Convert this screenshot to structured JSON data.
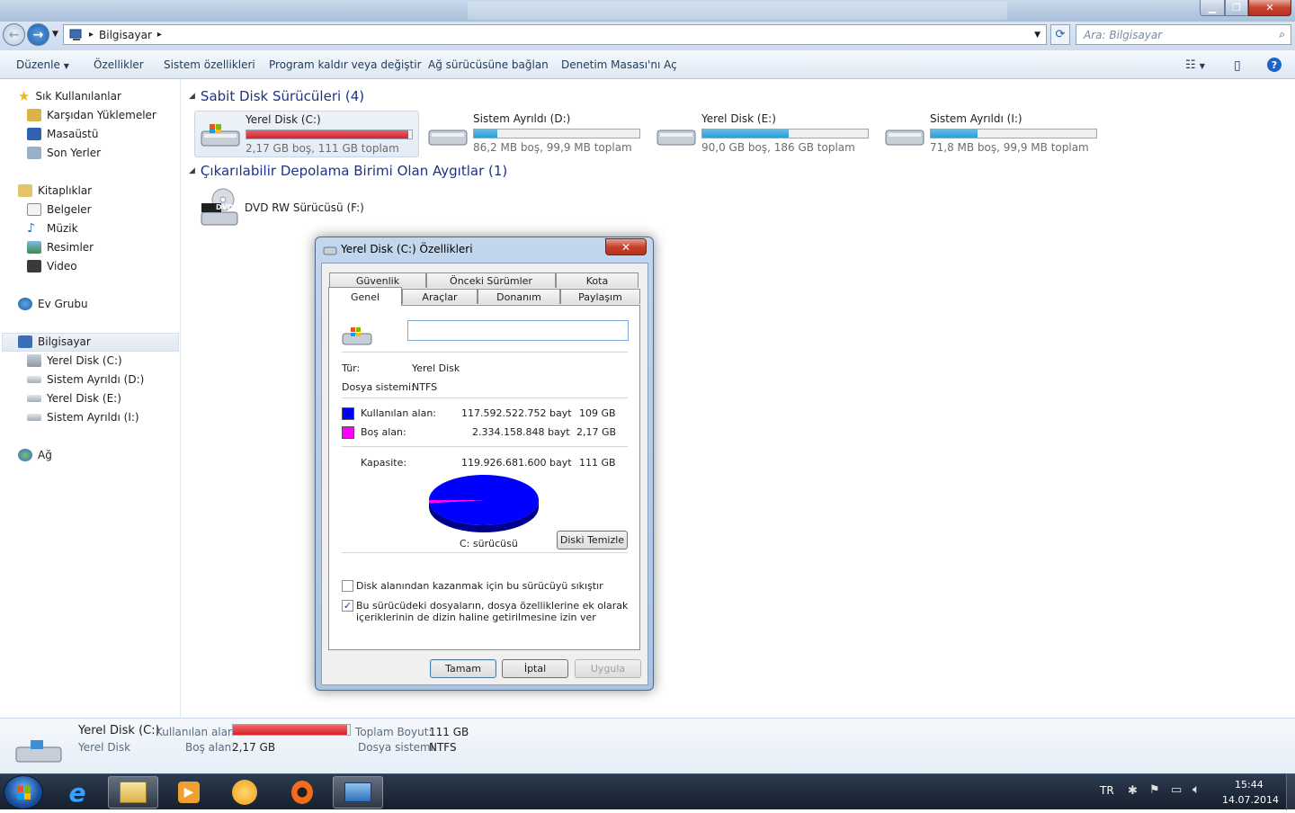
{
  "window": {
    "minimize_glyph": "▁",
    "maximize_glyph": "❐",
    "close_glyph": "✕"
  },
  "address": {
    "breadcrumb": "Bilgisayar",
    "search_placeholder": "Ara: Bilgisayar"
  },
  "toolbar": {
    "organize": "Düzenle",
    "properties": "Özellikler",
    "system_properties": "Sistem özellikleri",
    "uninstall": "Program kaldır veya değiştir",
    "map_drive": "Ağ sürücüsüne bağlan",
    "control_panel": "Denetim Masası'nı Aç"
  },
  "sidebar": {
    "favorites": {
      "label": "Sık Kullanılanlar",
      "items": [
        "Karşıdan Yüklemeler",
        "Masaüstü",
        "Son Yerler"
      ]
    },
    "libraries": {
      "label": "Kitaplıklar",
      "items": [
        "Belgeler",
        "Müzik",
        "Resimler",
        "Video"
      ]
    },
    "homegroup": "Ev Grubu",
    "computer": {
      "label": "Bilgisayar",
      "items": [
        "Yerel Disk (C:)",
        "Sistem Ayrıldı (D:)",
        "Yerel Disk (E:)",
        "Sistem Ayrıldı (I:)"
      ]
    },
    "network": "Ağ"
  },
  "groups": {
    "hdd_title": "Sabit Disk Sürücüleri (4)",
    "removable_title": "Çıkarılabilir Depolama Birimi Olan Aygıtlar (1)"
  },
  "drives": [
    {
      "name": "Yerel Disk (C:)",
      "free": "2,17 GB boş, 111 GB toplam",
      "used_fraction": 0.98,
      "color": "#d8202a"
    },
    {
      "name": "Sistem Ayrıldı (D:)",
      "free": "86,2 MB boş, 99,9 MB toplam",
      "used_fraction": 0.14,
      "color": "#26a0da"
    },
    {
      "name": "Yerel Disk (E:)",
      "free": "90,0 GB boş, 186 GB toplam",
      "used_fraction": 0.52,
      "color": "#26a0da"
    },
    {
      "name": "Sistem Ayrıldı (I:)",
      "free": "71,8 MB boş, 99,9 MB toplam",
      "used_fraction": 0.28,
      "color": "#26a0da"
    }
  ],
  "dvd": {
    "name": "DVD RW Sürücüsü (F:)",
    "badge": "DVD"
  },
  "dialog": {
    "title": "Yerel Disk (C:) Özellikleri",
    "close_glyph": "✕",
    "tabs_back": [
      "Güvenlik",
      "Önceki Sürümler",
      "Kota"
    ],
    "tabs_front": [
      "Genel",
      "Araçlar",
      "Donanım",
      "Paylaşım"
    ],
    "volume_label_value": "",
    "type_label": "Tür:",
    "type_value": "Yerel Disk",
    "fs_label": "Dosya sistemi:",
    "fs_value": "NTFS",
    "used_label": "Kullanılan alan:",
    "used_bytes": "117.592.522.752 bayt",
    "used_gb": "109 GB",
    "used_color": "#0000ff",
    "free_label": "Boş alan:",
    "free_bytes": "2.334.158.848 bayt",
    "free_gb": "2,17 GB",
    "free_color": "#ff00ff",
    "capacity_label": "Kapasite:",
    "capacity_bytes": "119.926.681.600 bayt",
    "capacity_gb": "111 GB",
    "pie_used_fraction": 0.9805,
    "drive_caption": "C: sürücüsü",
    "cleanup": "Diski Temizle",
    "compress": "Disk alanından kazanmak için bu sürücüyü sıkıştır",
    "compress_checked": false,
    "index_line1": "Bu sürücüdeki dosyaların, dosya özelliklerine ek olarak",
    "index_line2": "içeriklerinin de dizin haline getirilmesine izin ver",
    "index_checked": true,
    "check_glyph": "✓",
    "ok": "Tamam",
    "cancel": "İptal",
    "apply": "Uygula"
  },
  "details": {
    "name": "Yerel Disk (C:)",
    "type": "Yerel Disk",
    "used_label": "Kullanılan alan:",
    "free_label": "Boş alan:",
    "free_value": "2,17 GB",
    "total_label": "Toplam Boyut:",
    "total_value": "111 GB",
    "fs_label": "Dosya sistemi:",
    "fs_value": "NTFS",
    "used_fraction": 0.98
  },
  "taskbar": {
    "lang": "TR",
    "time": "15:44",
    "date": "14.07.2014"
  }
}
